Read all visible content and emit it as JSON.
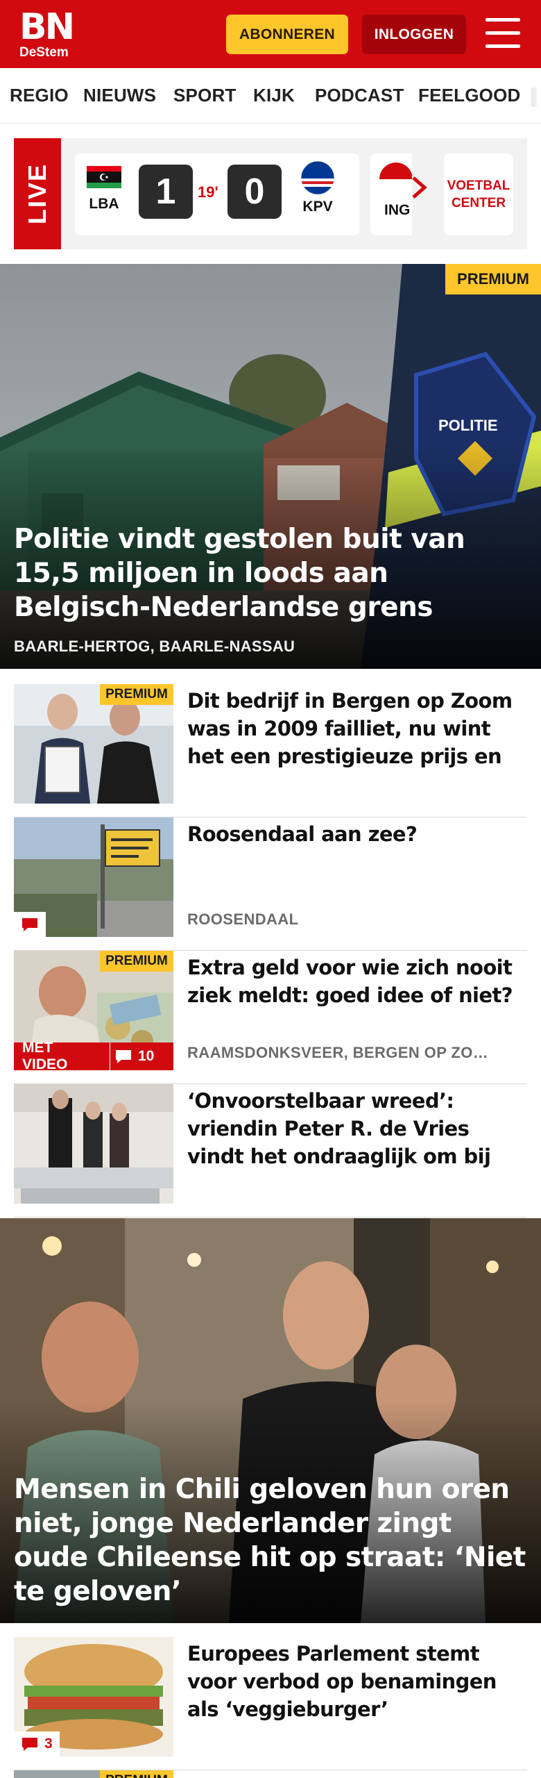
{
  "header": {
    "logo_main": "BN",
    "logo_sub": "DeStem",
    "subscribe_label": "ABONNEREN",
    "login_label": "INLOGGEN",
    "menu_icon": "hamburger-menu-icon",
    "brand_color": "#d10a10",
    "subscribe_color": "#ffc62b"
  },
  "nav": {
    "items": [
      "REGIO",
      "NIEUWS",
      "SPORT",
      "KIJK",
      "PODCAST",
      "FEELGOOD"
    ]
  },
  "live": {
    "label": "LIVE",
    "match": {
      "home_code": "LBA",
      "away_code": "KPV",
      "home_score": "1",
      "away_score": "0",
      "minute": "19'"
    },
    "next_match_code": "ING",
    "arrow_icon": "chevron-right-icon",
    "voetbal_center_line1": "VOETBAL",
    "voetbal_center_line2": "CENTER"
  },
  "hero": {
    "badge": "PREMIUM",
    "title": "Politie vindt gestolen buit van 15,5 miljoen in loods aan Belgisch-Nederlandse grens",
    "location": "BAARLE-HERTOG, BAARLE-NASSAU",
    "patch_text": "POLITIE"
  },
  "articles": [
    {
      "title": "Dit bedrijf in Bergen op Zoom was in 2009 failliet, nu wint het een prestigieuze prijs en maakt het…",
      "location": "",
      "premium": "PREMIUM",
      "comments": "",
      "video": ""
    },
    {
      "title": "Roosendaal aan zee?",
      "location": "ROOSENDAAL",
      "premium": "",
      "comments": "",
      "video": ""
    },
    {
      "title": "Extra geld voor wie zich nooit ziek meldt: goed idee of niet?",
      "location": "RAAMSDONKSVEER, BERGEN OP ZO…",
      "premium": "PREMIUM",
      "comments": "10",
      "video": "MET VIDEO"
    },
    {
      "title": "‘Onvoorstelbaar wreed’: vriendin Peter R. de Vries vindt het ondraaglijk om bij hoger beroep…",
      "location": "",
      "premium": "",
      "comments": "",
      "video": ""
    }
  ],
  "feature": {
    "title": "Mensen in Chili geloven hun oren niet, jonge Nederlander zingt oude Chileense hit op straat: ‘Niet te geloven’"
  },
  "bottom_article": {
    "title": "Europees Parlement stemt voor verbod op benamingen als ‘veggieburger’",
    "comments": "3",
    "next_badge": "PREMIUM"
  }
}
